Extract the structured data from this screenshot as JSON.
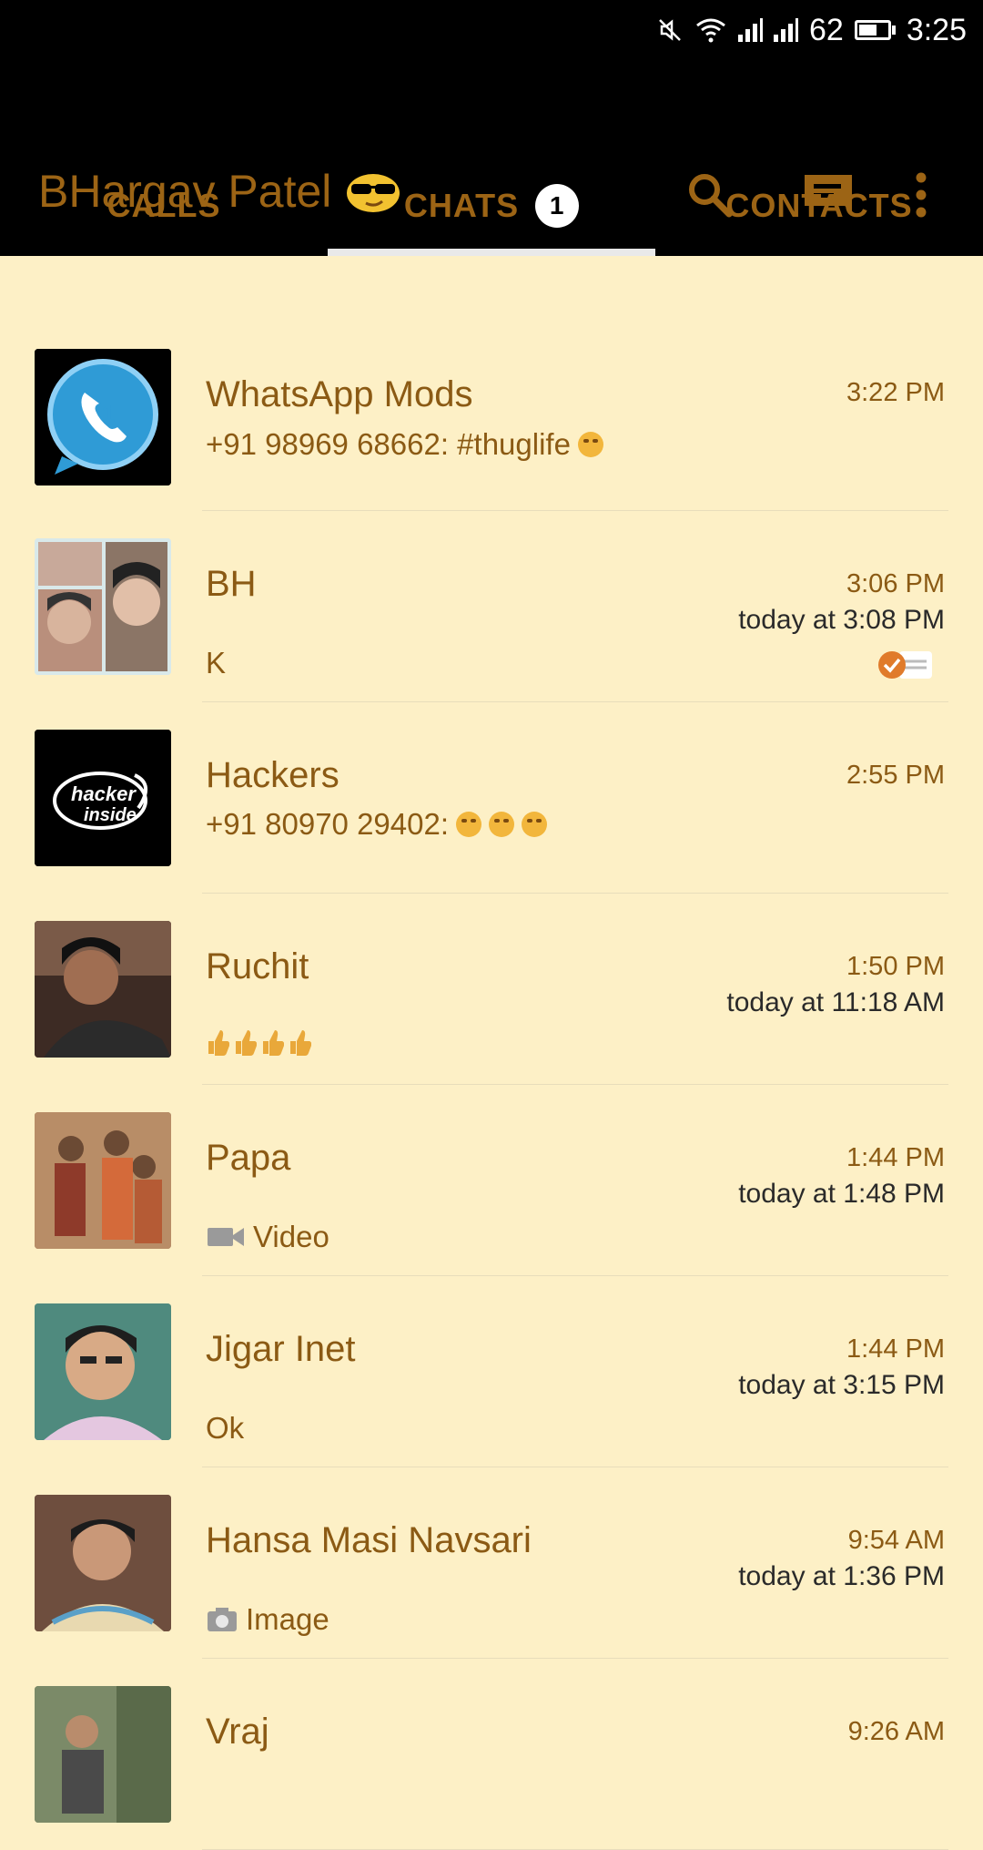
{
  "status_bar": {
    "battery": "62",
    "time": "3:25",
    "icons": [
      "mute-icon",
      "wifi-icon",
      "signal-icon",
      "signal-icon",
      "battery-icon"
    ]
  },
  "app_bar": {
    "title": "BHargav Patel",
    "title_emoji": "sunglasses-emoji",
    "actions": [
      "search-icon",
      "new-chat-icon",
      "more-vert-icon"
    ]
  },
  "tabs": [
    {
      "label": "CALLS"
    },
    {
      "label": "CHATS",
      "badge": "1",
      "active": true
    },
    {
      "label": "CONTACTS"
    }
  ],
  "chats": [
    {
      "name": "WhatsApp Mods",
      "time": "3:22 PM",
      "preview": "+91 98969 68662: #thuglife",
      "preview_icon": "grimace-emoji",
      "avatar": "whatsapp-mods-logo"
    },
    {
      "name": "BH",
      "time": "3:06 PM",
      "sub_time": "today at 3:08 PM",
      "preview": "K",
      "status_icon": "scheduled-check-icon",
      "avatar": "collage-photo"
    },
    {
      "name": "Hackers",
      "time": "2:55 PM",
      "preview": "+91 80970 29402:",
      "preview_icon": "laughing-emoji x3",
      "avatar": "hacker-inside-logo"
    },
    {
      "name": "Ruchit",
      "time": "1:50 PM",
      "sub_time": "today at 11:18 AM",
      "preview_icon": "thumbs-up-emoji x4",
      "avatar": "person-photo"
    },
    {
      "name": "Papa",
      "time": "1:44 PM",
      "sub_time": "today at 1:48 PM",
      "preview": "Video",
      "preview_icon": "video-icon",
      "avatar": "group-photo"
    },
    {
      "name": "Jigar Inet",
      "time": "1:44 PM",
      "sub_time": "today at 3:15 PM",
      "preview": "Ok",
      "avatar": "person-photo"
    },
    {
      "name": "Hansa Masi Navsari",
      "time": "9:54 AM",
      "sub_time": "today at 1:36 PM",
      "preview": "Image",
      "preview_icon": "camera-icon",
      "avatar": "person-photo"
    },
    {
      "name": "Vraj",
      "time": "9:26 AM",
      "avatar": "person-photo"
    }
  ],
  "colors": {
    "header_bg": "#000000",
    "accent_brown": "#9C6415",
    "list_bg": "#FDF0C6"
  }
}
